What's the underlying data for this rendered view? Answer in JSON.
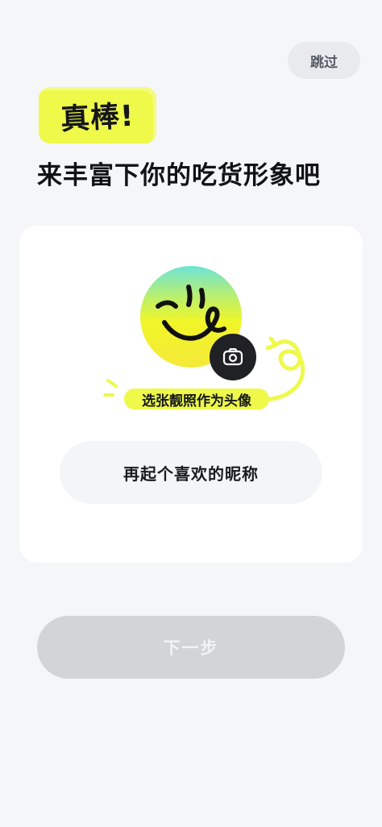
{
  "header": {
    "skip_label": "跳过",
    "badge_text": "真棒!",
    "title": "来丰富下你的吃货形象吧"
  },
  "profile_card": {
    "avatar_caption": "选张靓照作为头像",
    "nickname_label": "再起个喜欢的昵称"
  },
  "footer": {
    "next_label": "下一步"
  },
  "colors": {
    "accent_yellow": "#eef94a",
    "background": "#f5f6f8",
    "card": "#ffffff",
    "disabled_button": "#d3d4d8"
  },
  "icons": {
    "avatar": "smiley-face-icon",
    "camera": "camera-icon",
    "decor": "swirl-arrow-icon"
  }
}
